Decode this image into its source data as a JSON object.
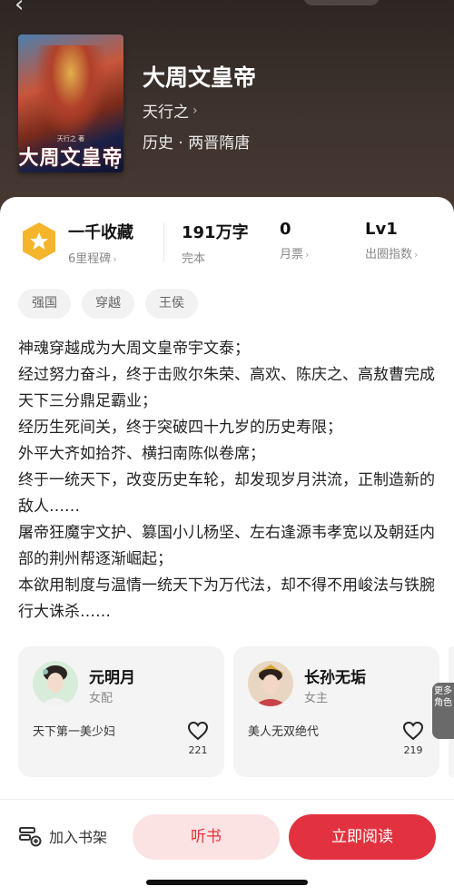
{
  "book": {
    "title": "大周文皇帝",
    "author": "天行之",
    "genre": "历史 · 两晋隋唐",
    "cover_title": "大周文皇帝",
    "cover_author": "天行之 著"
  },
  "stats": {
    "collection_value": "一千收藏",
    "collection_label": "6里程碑",
    "words_value": "191万字",
    "words_label": "完本",
    "tickets_value": "0",
    "tickets_label": "月票",
    "level_value": "Lv1",
    "level_label": "出圈指数"
  },
  "tags": [
    "强国",
    "穿越",
    "王侯"
  ],
  "synopsis": [
    "神魂穿越成为大周文皇帝宇文泰；",
    "经过努力奋斗，终于击败尔朱荣、高欢、陈庆之、高敖曹完成天下三分鼎足霸业；",
    "经历生死间关，终于突破四十九岁的历史寿限；",
    "外平大齐如拾芥、横扫南陈似卷席；",
    "终于一统天下，改变历史车轮，却发现岁月洪流，正制造新的敌人……",
    "屠帝狂魔宇文护、篡国小儿杨坚、左右逢源韦孝宽以及朝廷内部的荆州帮逐渐崛起；",
    "本欲用制度与温情一统天下为万代法，却不得不用峻法与铁腕行大诛杀……"
  ],
  "roles": [
    {
      "name": "元明月",
      "type": "女配",
      "desc": "天下第一美少妇",
      "likes": "221"
    },
    {
      "name": "长孙无垢",
      "type": "女主",
      "desc": "美人无双绝代",
      "likes": "219"
    }
  ],
  "more_roles": "更多角色",
  "actions": {
    "shelf": "加入书架",
    "listen": "听书",
    "read": "立即阅读"
  },
  "colors": {
    "accent": "#e3323f",
    "accent_light": "#fbe3e3",
    "medal": "#f5b52a"
  }
}
